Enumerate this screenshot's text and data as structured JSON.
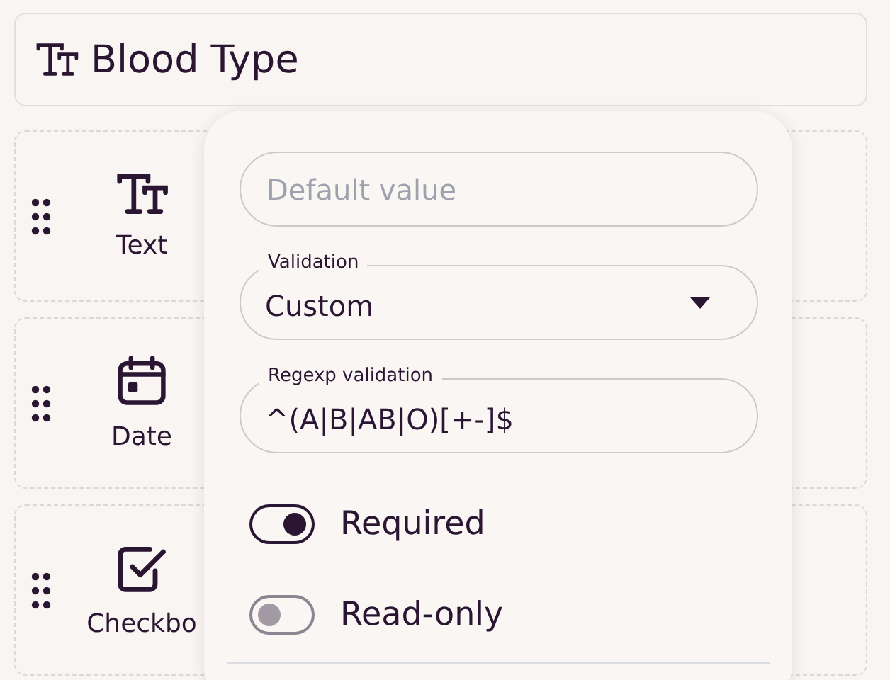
{
  "header": {
    "title": "Blood Type"
  },
  "fields": [
    {
      "kind": "text",
      "label": "Text"
    },
    {
      "kind": "date",
      "label": "Date"
    },
    {
      "kind": "checkbox",
      "label": "Checkbo"
    }
  ],
  "popover": {
    "default_value": {
      "placeholder": "Default value"
    },
    "validation": {
      "label": "Validation",
      "value": "Custom"
    },
    "regexp": {
      "label": "Regexp validation",
      "value": "^(A|B|AB|O)[+-]$"
    },
    "toggles": [
      {
        "label": "Required",
        "on": true
      },
      {
        "label": "Read-only",
        "on": false
      }
    ]
  }
}
